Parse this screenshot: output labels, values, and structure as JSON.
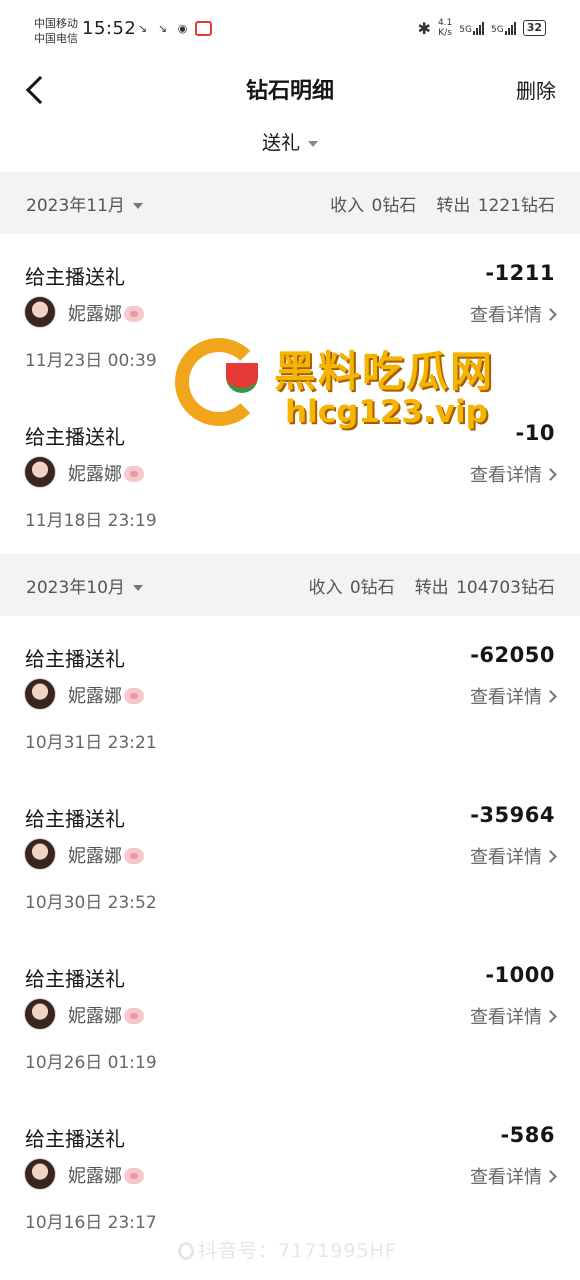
{
  "status_bar": {
    "carrier_1": "中国移动",
    "carrier_2": "中国电信",
    "time": "15:52",
    "net_speed": "4.1",
    "net_speed_unit": "K/s",
    "signal_1": "5G",
    "signal_2": "5G",
    "battery": "32"
  },
  "nav": {
    "title": "钻石明细",
    "delete_label": "删除"
  },
  "filter": {
    "label": "送礼"
  },
  "months": [
    {
      "label": "2023年11月",
      "income": "收入 0钻石",
      "outgoing": "转出 1221钻石",
      "records": [
        {
          "type": "给主播送礼",
          "amount": "-1211",
          "streamer": "妮露娜",
          "details_label": "查看详情",
          "time": "11月23日 00:39"
        },
        {
          "type": "给主播送礼",
          "amount": "-10",
          "streamer": "妮露娜",
          "details_label": "查看详情",
          "time": "11月18日 23:19"
        }
      ]
    },
    {
      "label": "2023年10月",
      "income": "收入 0钻石",
      "outgoing": "转出 104703钻石",
      "records": [
        {
          "type": "给主播送礼",
          "amount": "-62050",
          "streamer": "妮露娜",
          "details_label": "查看详情",
          "time": "10月31日 23:21"
        },
        {
          "type": "给主播送礼",
          "amount": "-35964",
          "streamer": "妮露娜",
          "details_label": "查看详情",
          "time": "10月30日 23:52"
        },
        {
          "type": "给主播送礼",
          "amount": "-1000",
          "streamer": "妮露娜",
          "details_label": "查看详情",
          "time": "10月26日 01:19"
        },
        {
          "type": "给主播送礼",
          "amount": "-586",
          "streamer": "妮露娜",
          "details_label": "查看详情",
          "time": "10月16日 23:17"
        }
      ]
    }
  ],
  "watermark": {
    "site_name": "黑料吃瓜网",
    "url": "hlcg123.vip",
    "douyin_id": "抖音号：7171995HF"
  },
  "colors": {
    "accent_watermark": "#f4b400",
    "month_bar_bg": "#f3f3f5",
    "text_primary": "#161616",
    "text_secondary": "#666666"
  }
}
